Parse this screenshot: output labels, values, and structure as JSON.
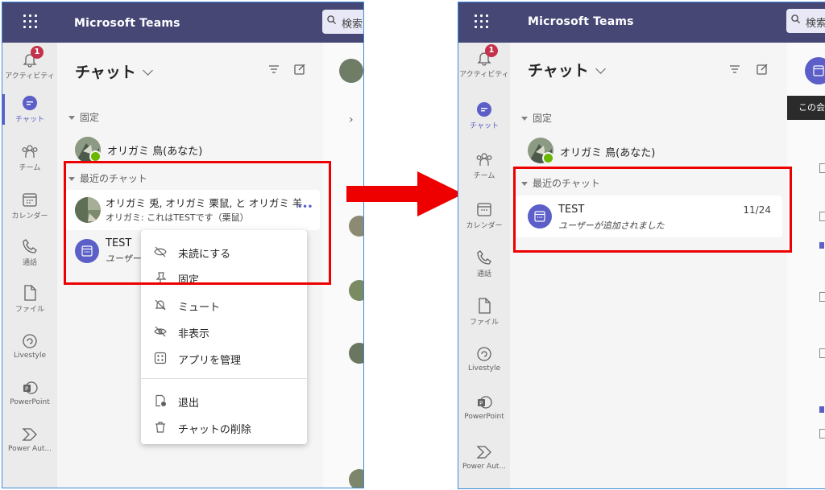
{
  "app": {
    "title": "Microsoft Teams",
    "search_placeholder": "検索"
  },
  "rail": {
    "items": [
      {
        "label": "アクティビティ",
        "icon": "bell-icon",
        "badge": "1"
      },
      {
        "label": "チャット",
        "icon": "chat-icon",
        "active": true
      },
      {
        "label": "チーム",
        "icon": "teams-icon"
      },
      {
        "label": "カレンダー",
        "icon": "calendar-icon"
      },
      {
        "label": "通話",
        "icon": "phone-icon"
      },
      {
        "label": "ファイル",
        "icon": "file-icon"
      },
      {
        "label": "Livestyle",
        "icon": "livestyle-icon"
      },
      {
        "label": "PowerPoint",
        "icon": "powerpoint-icon"
      },
      {
        "label": "Power Aut...",
        "icon": "power-automate-icon"
      }
    ]
  },
  "chat_header": {
    "title": "チャット"
  },
  "sections": {
    "pinned": "固定",
    "recent": "最近のチャット"
  },
  "pinned_chat": {
    "name": "オリガミ 鳥(あなた)"
  },
  "left": {
    "recent_chats": [
      {
        "name": "オリガミ 兎, オリガミ 栗鼠, と オリガミ 羊",
        "preview": "オリガミ: これはTESTです（栗鼠）",
        "more": "•••"
      },
      {
        "name": "TEST",
        "preview": "ユーザーが"
      }
    ],
    "context_menu": {
      "items": [
        {
          "label": "未読にする",
          "icon": "eye-off-icon"
        },
        {
          "label": "固定",
          "icon": "pin-icon"
        },
        {
          "label": "ミュート",
          "icon": "bell-off-icon"
        },
        {
          "label": "非表示",
          "icon": "hide-icon"
        },
        {
          "label": "アプリを管理",
          "icon": "apps-icon"
        },
        {
          "label": "退出",
          "icon": "leave-icon"
        },
        {
          "label": "チャットの削除",
          "icon": "trash-icon"
        }
      ]
    }
  },
  "right": {
    "recent_chats": [
      {
        "name": "TEST",
        "preview": "ユーザーが追加されました",
        "date": "11/24"
      }
    ],
    "tooltip": "この会"
  },
  "colors": {
    "brand": "#464775",
    "accent": "#5b5fc7",
    "highlight": "#ee0000"
  }
}
